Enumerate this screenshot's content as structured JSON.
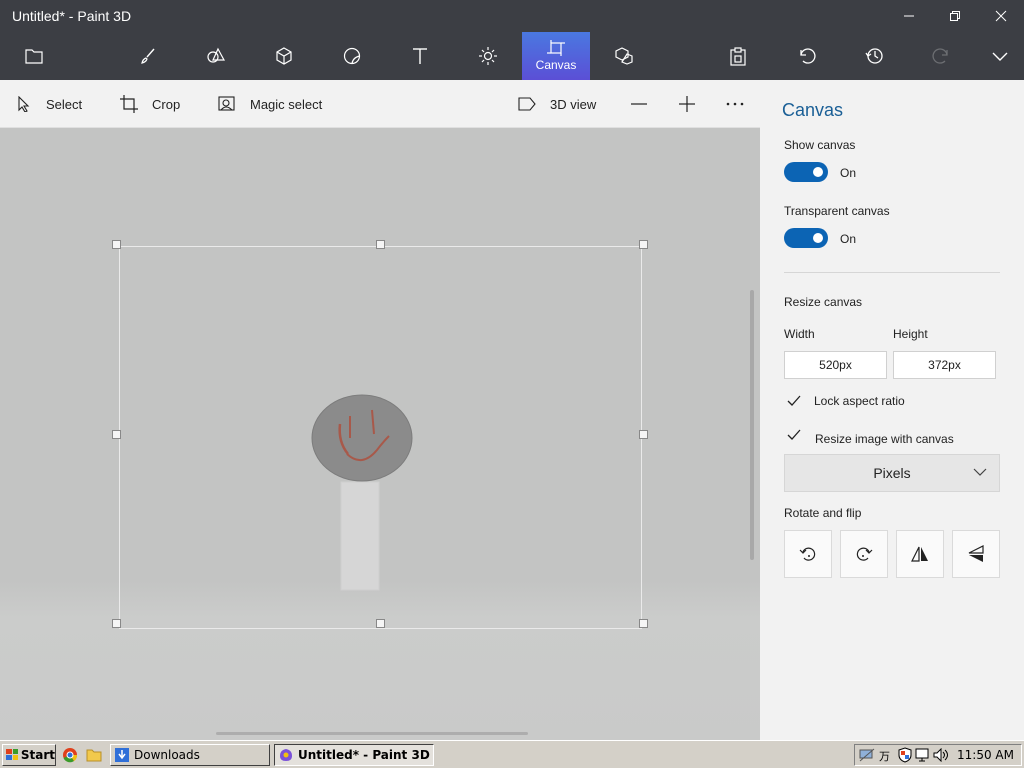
{
  "window": {
    "title": "Untitled* - Paint 3D"
  },
  "ribbon": {
    "items": [
      {
        "name": "menu",
        "icon": "folder-icon"
      },
      {
        "name": "brushes",
        "icon": "brush-icon"
      },
      {
        "name": "2d-shapes",
        "icon": "2d-shapes-icon"
      },
      {
        "name": "3d-shapes",
        "icon": "3d-shapes-icon"
      },
      {
        "name": "stickers",
        "icon": "stickers-icon"
      },
      {
        "name": "text",
        "icon": "text-icon"
      },
      {
        "name": "effects",
        "icon": "effects-icon"
      },
      {
        "name": "canvas",
        "icon": "canvas-icon",
        "label": "Canvas",
        "active": true
      },
      {
        "name": "3d-library",
        "icon": "3d-library-icon"
      }
    ],
    "paste_icon": "paste-icon",
    "undo_icon": "undo-icon",
    "history_icon": "history-icon",
    "redo_icon": "redo-icon",
    "expand_icon": "chevron-down-icon",
    "active_color": "#5b62dc"
  },
  "toolbar": {
    "select": "Select",
    "crop": "Crop",
    "magic_select": "Magic select",
    "view_3d": "3D view"
  },
  "panel": {
    "title": "Canvas",
    "show_canvas": {
      "label": "Show canvas",
      "state": "On",
      "on": true
    },
    "transparent_canvas": {
      "label": "Transparent canvas",
      "state": "On",
      "on": true
    },
    "resize_title": "Resize canvas",
    "width_label": "Width",
    "height_label": "Height",
    "width_value": "520px",
    "height_value": "372px",
    "lock_aspect": {
      "label": "Lock aspect ratio",
      "checked": true
    },
    "resize_image": {
      "label": "Resize image with canvas",
      "checked": true
    },
    "units": "Pixels",
    "rotate_title": "Rotate and flip",
    "accent": "#0c64b4"
  },
  "taskbar": {
    "start": "Start",
    "tasks": [
      "Downloads",
      "Untitled* - Paint 3D"
    ],
    "time": "11:50 AM"
  }
}
